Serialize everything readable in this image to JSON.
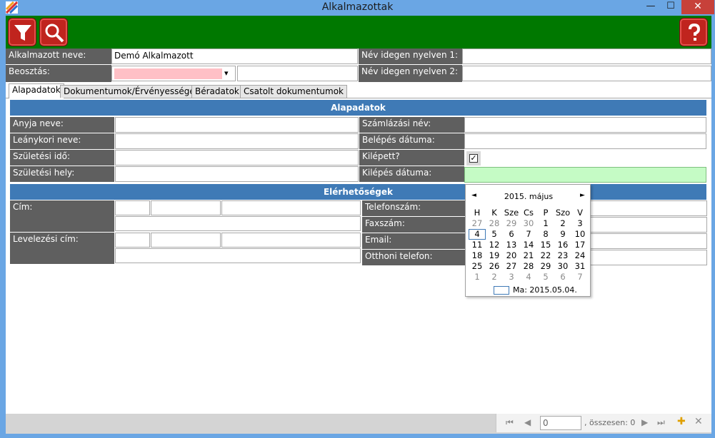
{
  "window": {
    "title": "Alkalmazottak",
    "min_glyph": "—",
    "max_glyph": "☐",
    "close_glyph": "✕"
  },
  "toolbar": {
    "filter_icon": "filter-icon",
    "search_icon": "search-icon",
    "help_icon": "help-icon",
    "accent": "#007800",
    "button_color": "#c0241e"
  },
  "header": {
    "employee_name_label": "Alkalmazott neve:",
    "employee_name_value": "Demó Alkalmazott",
    "position_label": "Beosztás:",
    "foreign_name1_label": "Név idegen nyelven 1:",
    "foreign_name2_label": "Név idegen nyelven 2:"
  },
  "tabs": [
    {
      "label": "Alapadatok",
      "active": true
    },
    {
      "label": "Dokumentumok/Érvényességek",
      "active": false
    },
    {
      "label": "Béradatok",
      "active": false
    },
    {
      "label": "Csatolt dokumentumok",
      "active": false
    }
  ],
  "basic": {
    "section_title": "Alapadatok",
    "mother_name": "Anyja neve:",
    "maiden_name": "Leánykori neve:",
    "birth_date": "Születési idő:",
    "birth_place": "Születési hely:",
    "billing_name": "Számlázási név:",
    "entry_date": "Belépés dátuma:",
    "left": "Kilépett?",
    "left_checked": true,
    "left_checkmark": "✓",
    "exit_date": "Kilépés dátuma:"
  },
  "contacts": {
    "section_title": "Elérhetőségek",
    "address": "Cím:",
    "mail_address": "Levelezési cím:",
    "phone": "Telefonszám:",
    "fax": "Faxszám:",
    "email": "Email:",
    "home_phone": "Otthoni telefon:"
  },
  "calendar": {
    "title": "2015. május",
    "prev": "◄",
    "next": "►",
    "weekdays": [
      "H",
      "K",
      "Sze",
      "Cs",
      "P",
      "Szo",
      "V"
    ],
    "weeks": [
      [
        "27",
        "28",
        "29",
        "30",
        "1",
        "2",
        "3"
      ],
      [
        "4",
        "5",
        "6",
        "7",
        "8",
        "9",
        "10"
      ],
      [
        "11",
        "12",
        "13",
        "14",
        "15",
        "16",
        "17"
      ],
      [
        "18",
        "19",
        "20",
        "21",
        "22",
        "23",
        "24"
      ],
      [
        "25",
        "26",
        "27",
        "28",
        "29",
        "30",
        "31"
      ],
      [
        "1",
        "2",
        "3",
        "4",
        "5",
        "6",
        "7"
      ]
    ],
    "today_text": "Ma: 2015.05.04."
  },
  "navigator": {
    "position_value": "0",
    "total_text": ", összesen: 0",
    "first_glyph": "⏮",
    "prev_glyph": "◀",
    "next_glyph": "▶",
    "last_glyph": "⏭",
    "add_glyph": "✚",
    "delete_glyph": "✕"
  }
}
